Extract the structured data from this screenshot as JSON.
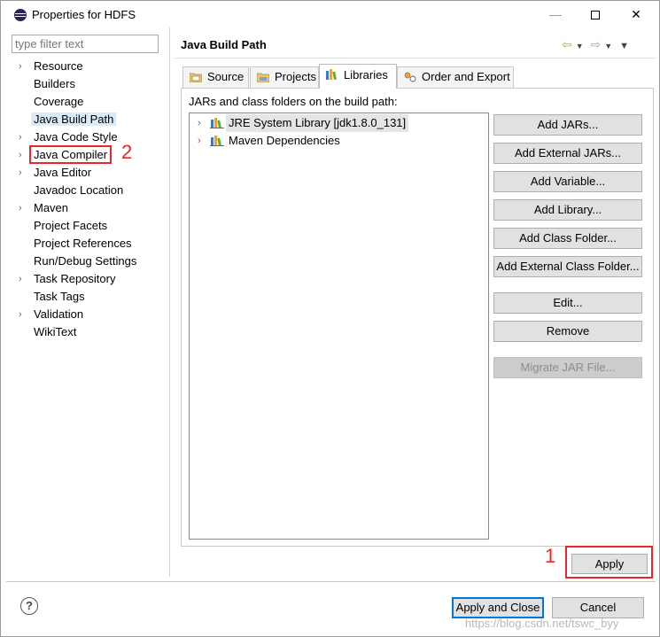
{
  "window": {
    "title": "Properties for HDFS",
    "minimize_glyph": "—",
    "close_glyph": "✕"
  },
  "filter": {
    "placeholder": "type filter text"
  },
  "tree": [
    {
      "label": "Resource",
      "expandable": true
    },
    {
      "label": "Builders",
      "expandable": false
    },
    {
      "label": "Coverage",
      "expandable": false
    },
    {
      "label": "Java Build Path",
      "expandable": false,
      "selected": true
    },
    {
      "label": "Java Code Style",
      "expandable": true
    },
    {
      "label": "Java Compiler",
      "expandable": true,
      "highlighted": true
    },
    {
      "label": "Java Editor",
      "expandable": true
    },
    {
      "label": "Javadoc Location",
      "expandable": false
    },
    {
      "label": "Maven",
      "expandable": true
    },
    {
      "label": "Project Facets",
      "expandable": false
    },
    {
      "label": "Project References",
      "expandable": false
    },
    {
      "label": "Run/Debug Settings",
      "expandable": false
    },
    {
      "label": "Task Repository",
      "expandable": true
    },
    {
      "label": "Task Tags",
      "expandable": false
    },
    {
      "label": "Validation",
      "expandable": true
    },
    {
      "label": "WikiText",
      "expandable": false
    }
  ],
  "annotations": {
    "one": "1",
    "two": "2"
  },
  "page": {
    "title": "Java Build Path"
  },
  "tabs": [
    {
      "label": "Source",
      "icon": "source-folder-icon"
    },
    {
      "label": "Projects",
      "icon": "projects-icon"
    },
    {
      "label": "Libraries",
      "icon": "libraries-icon",
      "active": true
    },
    {
      "label": "Order and Export",
      "icon": "order-export-icon"
    }
  ],
  "libraries": {
    "section_label": "JARs and class folders on the build path:",
    "items": [
      {
        "label": "JRE System Library [jdk1.8.0_131]",
        "selected": true
      },
      {
        "label": "Maven Dependencies",
        "selected": false
      }
    ]
  },
  "buttons": {
    "add_jars": "Add JARs...",
    "add_external_jars": "Add External JARs...",
    "add_variable": "Add Variable...",
    "add_library": "Add Library...",
    "add_class_folder": "Add Class Folder...",
    "add_external_class_folder": "Add External Class Folder...",
    "edit": "Edit...",
    "remove": "Remove",
    "migrate_jar": "Migrate JAR File...",
    "apply": "Apply",
    "apply_and_close": "Apply and Close",
    "cancel": "Cancel"
  },
  "help_glyph": "?",
  "watermark": "https://blog.csdn.net/tswc_byy",
  "colors": {
    "annotation_red": "#e8262b",
    "selection_blue": "#d9ebf9",
    "default_button_border": "#0078d7"
  }
}
